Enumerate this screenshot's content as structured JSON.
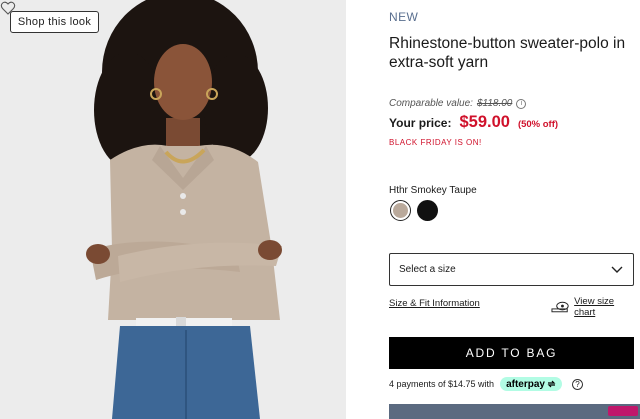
{
  "photo": {
    "shop_look_label": "Shop this look",
    "heart_icon": "heart-outline-icon"
  },
  "product": {
    "badge": "NEW",
    "title": "Rhinestone-button sweater-polo in extra-soft yarn",
    "comparable_label": "Comparable value:",
    "comparable_price": "$118.00",
    "price_label": "Your price:",
    "price": "$59.00",
    "discount": "(50% off)",
    "promo": "BLACK FRIDAY IS ON!",
    "color_name": "Hthr Smokey Taupe",
    "swatches": [
      {
        "name": "Hthr Smokey Taupe",
        "color": "#b9a99b",
        "selected": true
      },
      {
        "name": "Black",
        "color": "#111111",
        "selected": false
      }
    ],
    "size_select_label": "Select a size",
    "size_fit_link": "Size & Fit Information",
    "size_chart_link": "View size chart",
    "add_to_bag": "ADD TO BAG",
    "afterpay_text": "4 payments of $14.75 with",
    "afterpay_brand": "afterpay",
    "help_icon": "?"
  },
  "colors": {
    "sale_red": "#d0112b",
    "new_badge": "#5a6f8f",
    "button_black": "#000000",
    "afterpay_mint": "#b2fce4"
  }
}
